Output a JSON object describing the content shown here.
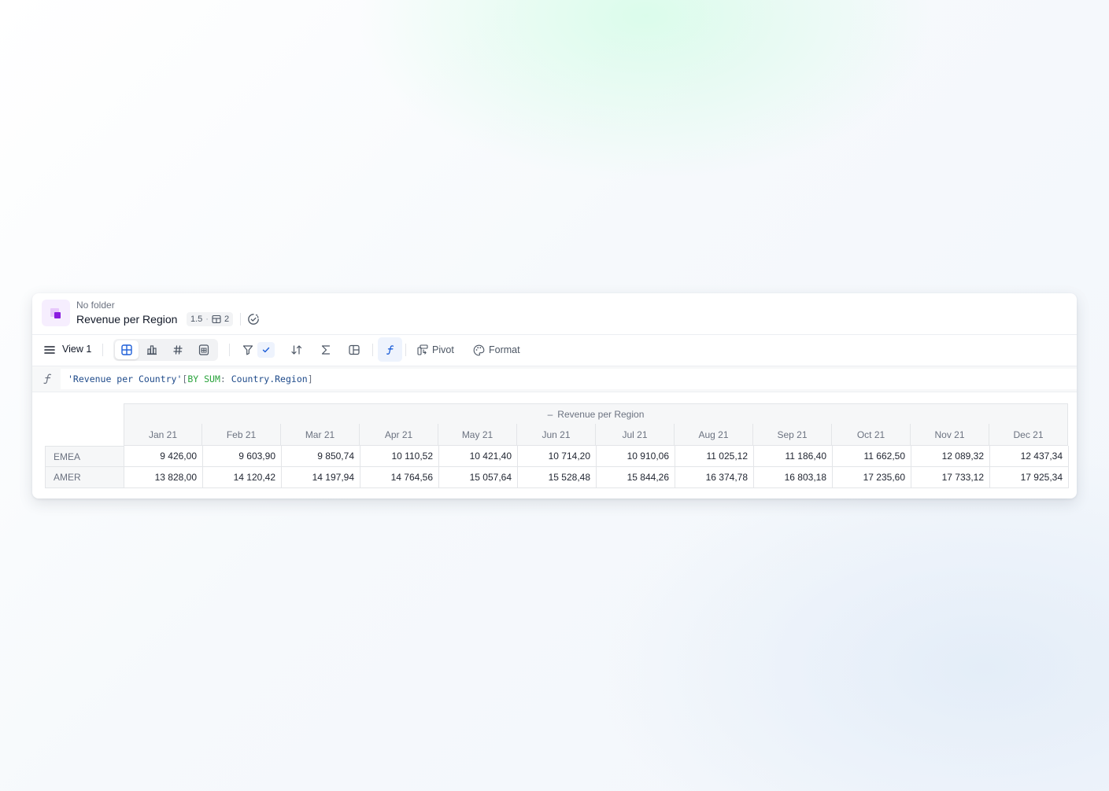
{
  "header": {
    "folder": "No folder",
    "title": "Revenue per Region",
    "badge_value": "1.5",
    "badge_count": "2"
  },
  "toolbar": {
    "view_label": "View 1",
    "pivot_label": "Pivot",
    "format_label": "Format"
  },
  "formula": {
    "part1": "'Revenue per Country'",
    "part2": "[",
    "part3": "BY SUM",
    "part4": ": ",
    "part5": "Country.Region",
    "part6": "]"
  },
  "table": {
    "group_header": "Revenue per Region",
    "group_collapse_glyph": "–",
    "columns": [
      "Jan 21",
      "Feb 21",
      "Mar 21",
      "Apr 21",
      "May 21",
      "Jun 21",
      "Jul 21",
      "Aug 21",
      "Sep 21",
      "Oct 21",
      "Nov 21",
      "Dec 21"
    ],
    "rows": [
      {
        "label": "EMEA",
        "values": [
          "9 426,00",
          "9 603,90",
          "9 850,74",
          "10 110,52",
          "10 421,40",
          "10 714,20",
          "10 910,06",
          "11 025,12",
          "11 186,40",
          "11 662,50",
          "12 089,32",
          "12 437,34"
        ]
      },
      {
        "label": "AMER",
        "values": [
          "13 828,00",
          "14 120,42",
          "14 197,94",
          "14 764,56",
          "15 057,64",
          "15 528,48",
          "15 844,26",
          "16 374,78",
          "16 803,18",
          "17 235,60",
          "17 733,12",
          "17 925,34"
        ]
      }
    ]
  },
  "colors": {
    "accent": "#1e5fd8",
    "brand_purple": "#8a1be0",
    "formula_keyword": "#2aa33c",
    "formula_identifier": "#1e4a8a"
  }
}
